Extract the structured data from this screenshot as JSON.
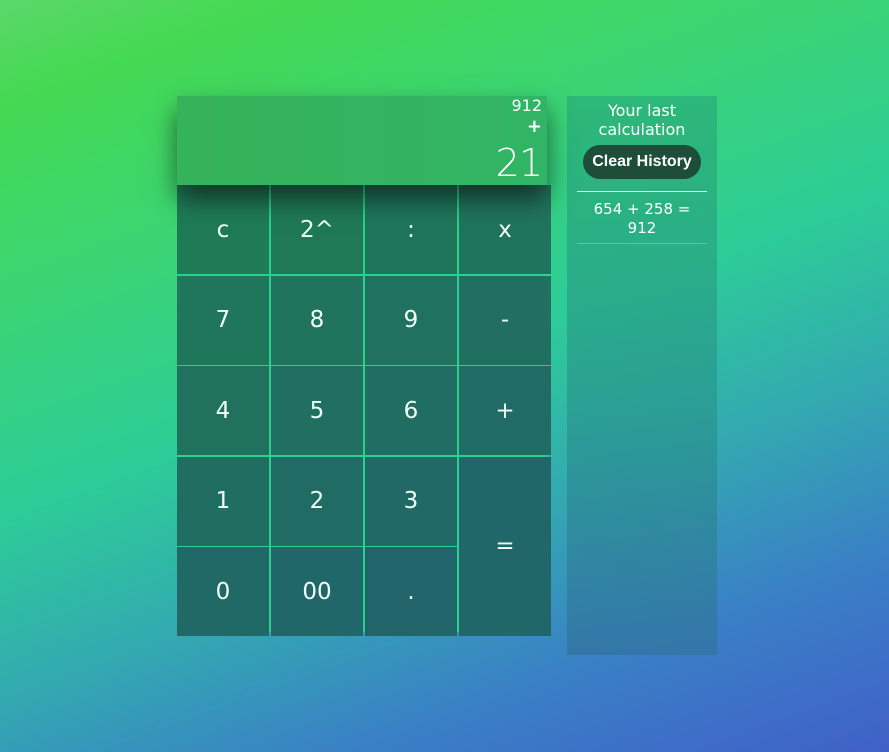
{
  "display": {
    "previous": "912",
    "operator": "+",
    "current": "21"
  },
  "keys": [
    {
      "id": "clear",
      "label": "c"
    },
    {
      "id": "power",
      "label": "2^"
    },
    {
      "id": "divide",
      "label": ":"
    },
    {
      "id": "multiply",
      "label": "x"
    },
    {
      "id": "7",
      "label": "7"
    },
    {
      "id": "8",
      "label": "8"
    },
    {
      "id": "9",
      "label": "9"
    },
    {
      "id": "minus",
      "label": "-"
    },
    {
      "id": "4",
      "label": "4"
    },
    {
      "id": "5",
      "label": "5"
    },
    {
      "id": "6",
      "label": "6"
    },
    {
      "id": "plus",
      "label": "+"
    },
    {
      "id": "1",
      "label": "1"
    },
    {
      "id": "2",
      "label": "2"
    },
    {
      "id": "3",
      "label": "3"
    },
    {
      "id": "equals",
      "label": "="
    },
    {
      "id": "0",
      "label": "0"
    },
    {
      "id": "00",
      "label": "00"
    },
    {
      "id": "dot",
      "label": "."
    }
  ],
  "history": {
    "title": "Your last calculation",
    "clear_label": "Clear History",
    "entries": [
      "654 + 258 = 912"
    ]
  },
  "colors": {
    "key_bg": "#1f7a56",
    "grid_line": "#2bcf8e",
    "display_bg": "#35b25a",
    "clear_button_bg": "#1e4d3a"
  }
}
